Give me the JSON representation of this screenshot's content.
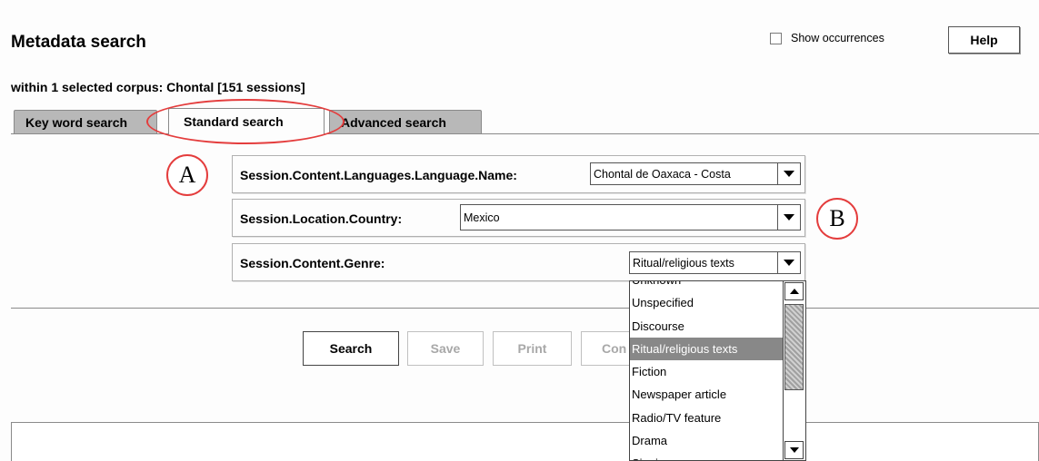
{
  "header": {
    "title": "Metadata search",
    "within": "within 1 selected corpus: Chontal [151 sessions]",
    "show_occurrences_label": "Show occurrences",
    "show_occurrences_checked": false,
    "help_label": "Help"
  },
  "tabs": [
    {
      "label": "Key word search",
      "active": false
    },
    {
      "label": "Standard search",
      "active": true
    },
    {
      "label": "Advanced search",
      "active": false
    }
  ],
  "fields": [
    {
      "label": "Session.Content.Languages.Language.Name:",
      "value": "Chontal de Oaxaca - Costa"
    },
    {
      "label": "Session.Location.Country:",
      "value": "Mexico"
    },
    {
      "label": "Session.Content.Genre:",
      "value": "Ritual/religious texts"
    }
  ],
  "annotations": {
    "a": "A",
    "b": "B"
  },
  "buttons": {
    "search": "Search",
    "save": "Save",
    "print": "Print",
    "con": "Con"
  },
  "genre_dropdown": {
    "options": [
      "Unknown",
      "Unspecified",
      "Discourse",
      "Ritual/religious texts",
      "Fiction",
      "Newspaper article",
      "Radio/TV feature",
      "Drama",
      "Singing"
    ],
    "selected": "Ritual/religious texts"
  },
  "colors": {
    "annotation_red": "#e43d3d",
    "tab_inactive": "#b8b8b8",
    "selected_option": "#888888"
  }
}
